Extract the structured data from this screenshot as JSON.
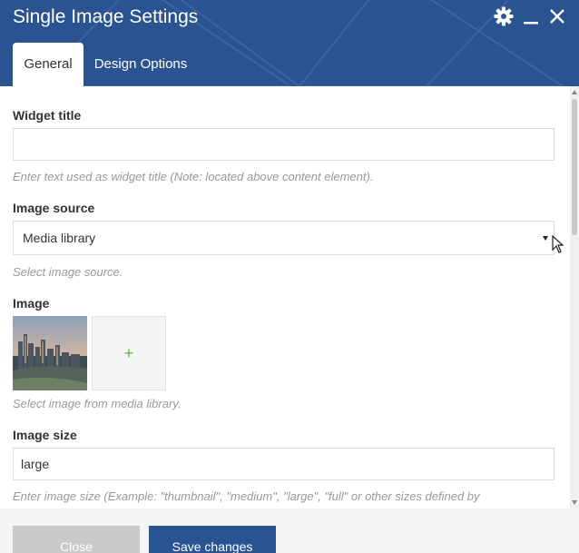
{
  "window": {
    "title": "Single Image Settings",
    "controls": [
      "gear-icon",
      "minimize-icon",
      "close-icon"
    ]
  },
  "tabs": [
    {
      "label": "General",
      "active": true
    },
    {
      "label": "Design Options",
      "active": false
    }
  ],
  "fields": {
    "widget_title": {
      "label": "Widget title",
      "value": "",
      "help": "Enter text used as widget title (Note: located above content element)."
    },
    "image_source": {
      "label": "Image source",
      "selected": "Media library",
      "help": "Select image source."
    },
    "image": {
      "label": "Image",
      "add_symbol": "+",
      "help": "Select image from media library."
    },
    "image_size": {
      "label": "Image size",
      "value": "large",
      "help": "Enter image size (Example: \"thumbnail\", \"medium\", \"large\", \"full\" or other sizes defined by"
    }
  },
  "footer": {
    "close_label": "Close",
    "save_label": "Save changes"
  },
  "colors": {
    "header": "#2a5392",
    "accent_plus": "#6ab04c",
    "close_button": "#c9c9c9",
    "save_button": "#2a5392"
  }
}
